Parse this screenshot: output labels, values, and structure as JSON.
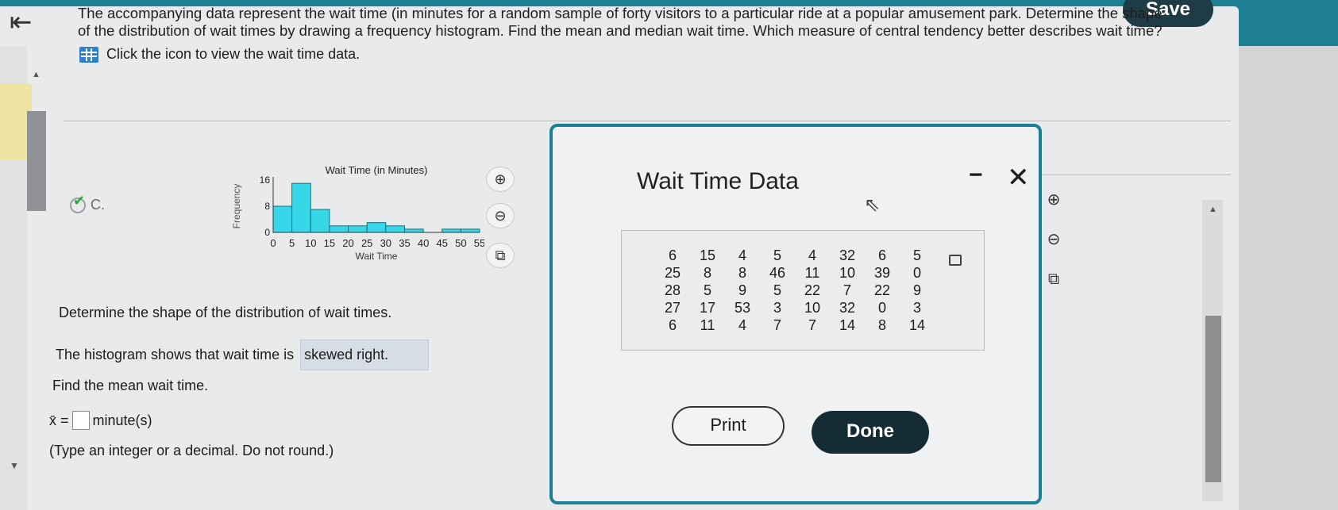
{
  "header": {
    "back_icon": "arrow-left-bar-icon",
    "save_label": "Save"
  },
  "question": {
    "line1": "The accompanying data represent the wait time (in minutes for a random sample of forty visitors to a particular ride at a popular amusement park. Determine the shape",
    "line2": "of the distribution of wait times by drawing a frequency histogram. Find the mean and median wait time. Which measure of central tendency better describes wait time?",
    "data_link": "Click the icon to view the wait time data."
  },
  "option": {
    "label": "C."
  },
  "chart_data": {
    "type": "bar",
    "title": "Wait Time (in Minutes)",
    "xlabel": "Wait Time",
    "ylabel": "Frequency",
    "bins": [
      0,
      5,
      10,
      15,
      20,
      25,
      30,
      35,
      40,
      45,
      50,
      55
    ],
    "x_tick_labels": [
      "0",
      "5",
      "10",
      "15",
      "20",
      "25",
      "30",
      "35",
      "40",
      "45",
      "50",
      "55"
    ],
    "y_tick_labels": [
      "0",
      "8",
      "16"
    ],
    "values": [
      8,
      15,
      7,
      2,
      2,
      3,
      2,
      1,
      0,
      1,
      1
    ],
    "ylim": [
      0,
      16
    ]
  },
  "answers": {
    "shape_question": "Determine the shape of the distribution of wait times.",
    "shape_prefix": "The histogram shows that wait time is",
    "shape_answer": "skewed right.",
    "mean_question": "Find the mean wait time.",
    "mean_symbol": "x̄ =",
    "mean_unit": "minute(s)",
    "hint": "(Type an integer or a decimal. Do not round.)"
  },
  "modal": {
    "title": "Wait Time Data",
    "minimize_label": "−",
    "close_label": "✕",
    "rows": [
      [
        "6",
        "15",
        "4",
        "5",
        "4",
        "32",
        "6",
        "5"
      ],
      [
        "25",
        "8",
        "8",
        "46",
        "11",
        "10",
        "39",
        "0"
      ],
      [
        "28",
        "5",
        "9",
        "5",
        "22",
        "7",
        "22",
        "9"
      ],
      [
        "27",
        "17",
        "53",
        "3",
        "10",
        "32",
        "0",
        "3"
      ],
      [
        "6",
        "11",
        "4",
        "7",
        "7",
        "14",
        "8",
        "14"
      ]
    ],
    "print_label": "Print",
    "done_label": "Done"
  },
  "icons": {
    "zoom_in": "zoom-in-icon",
    "zoom_out": "zoom-out-icon",
    "popout": "popout-icon"
  }
}
